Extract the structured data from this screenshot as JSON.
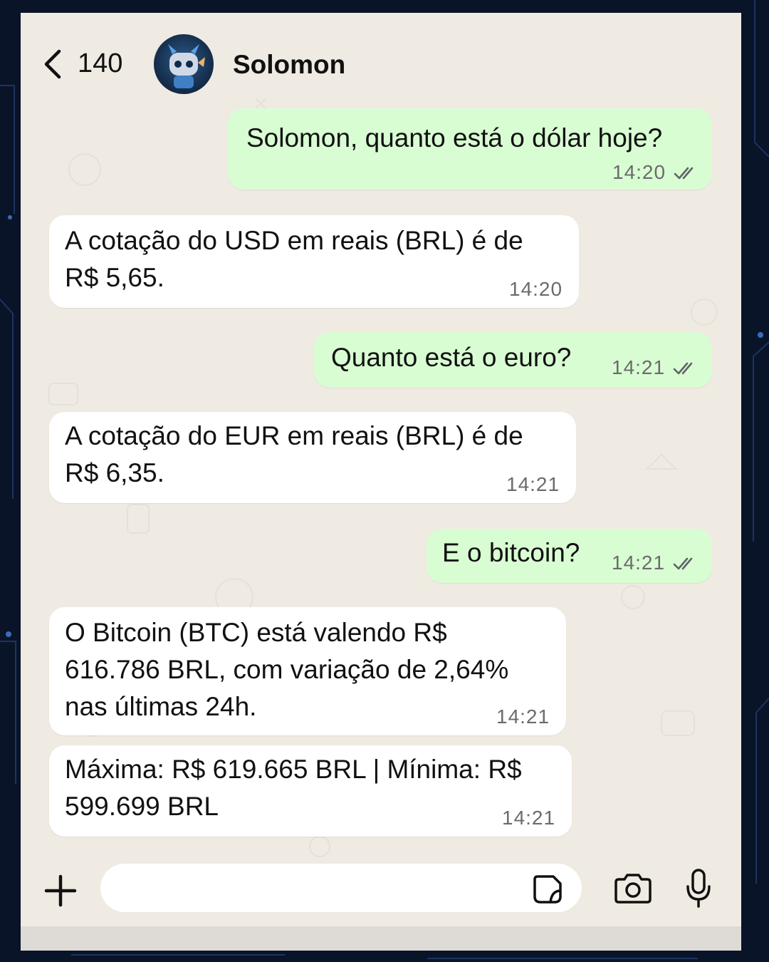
{
  "header": {
    "back_count": "140",
    "contact_name": "Solomon"
  },
  "messages": [
    {
      "direction": "out",
      "text": "Solomon, quanto está o dólar hoje?",
      "time": "14:20",
      "status": "read"
    },
    {
      "direction": "in",
      "text": "A cotação do USD em reais (BRL) é de\nR$ 5,65.",
      "time": "14:20"
    },
    {
      "direction": "out",
      "text": "Quanto está o euro?",
      "time": "14:21",
      "status": "read"
    },
    {
      "direction": "in",
      "text": "A cotação do EUR em reais (BRL) é de\nR$ 6,35.",
      "time": "14:21"
    },
    {
      "direction": "out",
      "text": "E o bitcoin?",
      "time": "14:21",
      "status": "read"
    },
    {
      "direction": "in",
      "text": "O Bitcoin (BTC) está valendo R$\n616.786 BRL, com variação de 2,64%\nnas últimas 24h.",
      "time": "14:21"
    },
    {
      "direction": "in",
      "text": "Máxima: R$ 619.665 BRL | Mínima: R$\n599.699 BRL",
      "time": "14:21"
    }
  ],
  "composer": {
    "placeholder": "",
    "icons": [
      "plus-icon",
      "sticker-icon",
      "camera-icon",
      "microphone-icon"
    ]
  },
  "colors": {
    "outgoing_bubble": "#d9fdd3",
    "incoming_bubble": "#ffffff",
    "chat_background": "#efeae2",
    "read_ticks": "#5f6368",
    "outer_background": "#0a1428"
  }
}
